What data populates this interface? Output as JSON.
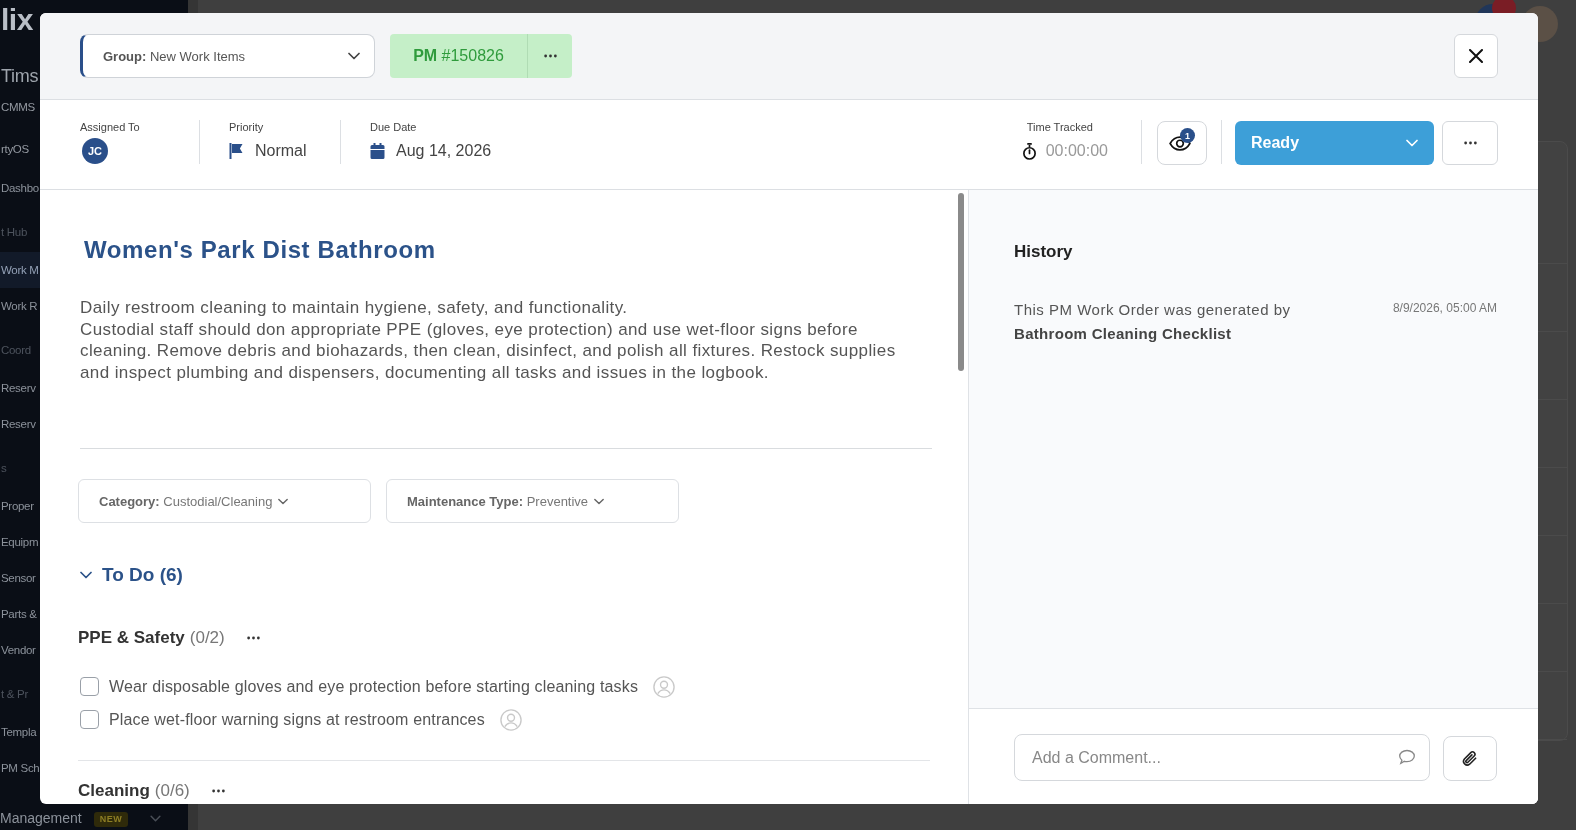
{
  "sidebar": {
    "items": [
      {
        "kind": "logo",
        "label": "lix"
      },
      {
        "kind": "workspace",
        "label": "Tims"
      },
      {
        "kind": "app",
        "label": "CMMS",
        "selected": false
      },
      {
        "kind": "app",
        "label": "rtyOS",
        "selected": false
      },
      {
        "kind": "item",
        "label": "Dashbo",
        "selected": false
      },
      {
        "kind": "header",
        "label": "t Hub"
      },
      {
        "kind": "item",
        "label": "Work M",
        "selected": true
      },
      {
        "kind": "item",
        "label": "Work R",
        "selected": false
      },
      {
        "kind": "header",
        "label": "Coord"
      },
      {
        "kind": "item",
        "label": "Reserv",
        "selected": false
      },
      {
        "kind": "item",
        "label": "Reserv",
        "selected": false
      },
      {
        "kind": "header",
        "label": "s"
      },
      {
        "kind": "item",
        "label": "Proper",
        "selected": false
      },
      {
        "kind": "item",
        "label": "Equipm",
        "selected": false
      },
      {
        "kind": "item",
        "label": "Sensor",
        "selected": false
      },
      {
        "kind": "item",
        "label": "Parts &",
        "selected": false
      },
      {
        "kind": "item",
        "label": "Vendor",
        "selected": false
      },
      {
        "kind": "header",
        "label": "t & Pr"
      },
      {
        "kind": "item",
        "label": "Templa",
        "selected": false
      },
      {
        "kind": "item",
        "label": "PM Sch",
        "selected": false
      },
      {
        "kind": "group",
        "label": "Management",
        "badge": "NEW",
        "expanded": false
      }
    ]
  },
  "work_order": {
    "group": "**Group:** New Work Items",
    "number": "**PM** #150826",
    "assigned_to": {
      "label": "Assigned To",
      "initials": "JC"
    },
    "priority": {
      "label": "Priority",
      "value": "Normal"
    },
    "due_date": {
      "label": "Due Date",
      "value": "Aug 14, 2026"
    },
    "time_tracked": {
      "label": "Time Tracked",
      "value": "00:00:00"
    },
    "watchers": {
      "count": "1"
    },
    "status": {
      "value": "Ready"
    },
    "title": "Women's Park Dist Bathroom",
    "description": [
      "Daily restroom cleaning to maintain hygiene, safety, and functionality.",
      "Custodial staff should don appropriate PPE (gloves, eye protection) and use wet-floor signs before cleaning. Remove debris and biohazards, then clean, disinfect, and polish all fixtures. Restock supplies and inspect plumbing and dispensers, documenting all tasks and issues in the logbook."
    ],
    "fields": [
      "**Category:** Custodial/Cleaning",
      "**Maintenance Type:** Preventive"
    ],
    "todo": {
      "title": "To Do (6)",
      "expanded": true,
      "groups": [
        {
          "name": "PPE & Safety",
          "count": "(0/2)",
          "tasks": [
            {
              "text": "Wear disposable gloves and eye protection before starting cleaning tasks",
              "checked": false
            },
            {
              "text": "Place wet-floor warning signs at restroom entrances",
              "checked": false
            }
          ]
        },
        {
          "name": "Cleaning",
          "count": "(0/6)"
        }
      ]
    },
    "history": {
      "title": "History",
      "entries": [
        {
          "text": "This PM Work Order was generated by **Bathroom Cleaning Checklist**",
          "time": "8/9/2026, 05:00 AM"
        }
      ]
    },
    "comment": {
      "placeholder": "Add a Comment..."
    }
  }
}
